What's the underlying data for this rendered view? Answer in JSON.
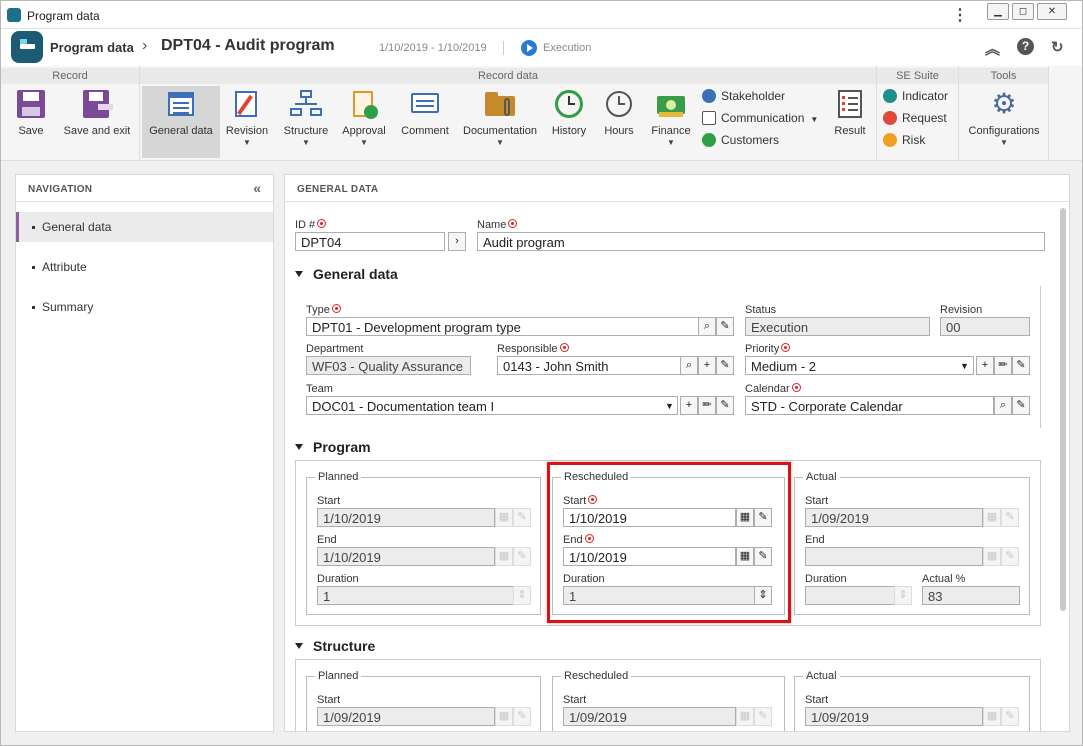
{
  "window": {
    "title": "Program data"
  },
  "header": {
    "breadcrumb_root": "Program data",
    "breadcrumb_current": "DPT04 - Audit program",
    "dates": "1/10/2019 - 1/10/2019",
    "status": "Execution"
  },
  "ribbon": {
    "groups": {
      "record": "Record",
      "record_data": "Record data",
      "se_suite": "SE Suite",
      "tools": "Tools"
    },
    "save": "Save",
    "save_exit": "Save and exit",
    "general_data": "General data",
    "revision": "Revision",
    "structure": "Structure",
    "approval": "Approval",
    "comment": "Comment",
    "documentation": "Documentation",
    "history": "History",
    "hours": "Hours",
    "finance": "Finance",
    "stakeholder": "Stakeholder",
    "communication": "Communication",
    "customers": "Customers",
    "result": "Result",
    "indicator": "Indicator",
    "request": "Request",
    "risk": "Risk",
    "configurations": "Configurations"
  },
  "navigation": {
    "title": "NAVIGATION",
    "items": [
      "General data",
      "Attribute",
      "Summary"
    ]
  },
  "main": {
    "title": "GENERAL DATA",
    "id_label": "ID #",
    "id_value": "DPT04",
    "name_label": "Name",
    "name_value": "Audit program",
    "section_general": "General data",
    "type_label": "Type",
    "type_value": "DPT01 - Development program type",
    "status_label": "Status",
    "status_value": "Execution",
    "revision_label": "Revision",
    "revision_value": "00",
    "department_label": "Department",
    "department_value": "WF03 - Quality Assurance",
    "responsible_label": "Responsible",
    "responsible_value": "0143 - John Smith",
    "priority_label": "Priority",
    "priority_value": "Medium - 2",
    "team_label": "Team",
    "team_value": "DOC01 - Documentation team I",
    "calendar_label": "Calendar",
    "calendar_value": "STD - Corporate Calendar",
    "section_program": "Program",
    "planned": "Planned",
    "rescheduled": "Rescheduled",
    "actual": "Actual",
    "start_label": "Start",
    "end_label": "End",
    "duration_label": "Duration",
    "actual_pct_label": "Actual %",
    "prog_planned_start": "1/10/2019",
    "prog_planned_end": "1/10/2019",
    "prog_planned_duration": "1",
    "prog_res_start": "1/10/2019",
    "prog_res_end": "1/10/2019",
    "prog_res_duration": "1",
    "prog_actual_start": "1/09/2019",
    "prog_actual_end": "",
    "prog_actual_duration": "",
    "prog_actual_pct": "83",
    "section_structure": "Structure",
    "str_planned_start": "1/09/2019",
    "str_res_start": "1/09/2019",
    "str_actual_start": "1/09/2019"
  }
}
